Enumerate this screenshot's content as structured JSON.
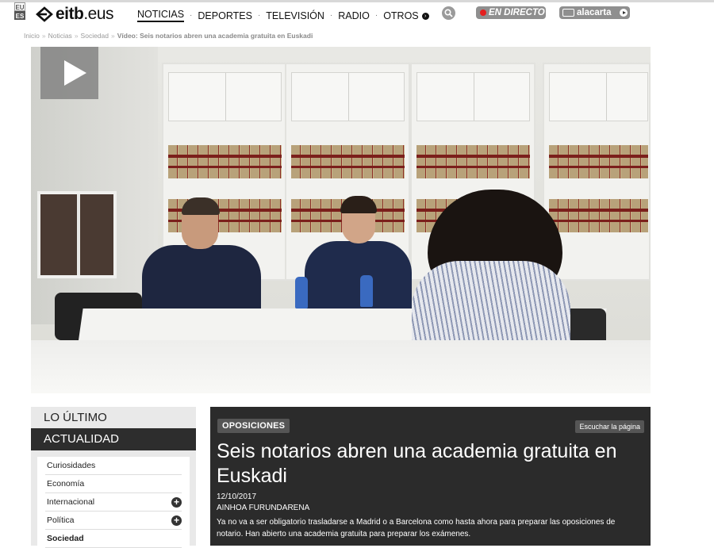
{
  "lang": {
    "eu": "EU",
    "es": "ES"
  },
  "logo": {
    "name": "eitb",
    "suffix": ".eus"
  },
  "nav": {
    "items": [
      "NOTICIAS",
      "DEPORTES",
      "TELEVISIÓN",
      "RADIO",
      "OTROS"
    ],
    "active": "NOTICIAS"
  },
  "header": {
    "live_label": "EN DIRECTO",
    "alacarta_label": "alacarta"
  },
  "breadcrumb": {
    "items": [
      "Inicio",
      "Noticias",
      "Sociedad"
    ],
    "current": "Vídeo: Seis notarios abren una academia gratuita en Euskadi"
  },
  "sidebar": {
    "tab_latest": "LO ÚLTIMO",
    "tab_active": "ACTUALIDAD",
    "items": [
      {
        "label": "Curiosidades",
        "expandable": false
      },
      {
        "label": "Economía",
        "expandable": false
      },
      {
        "label": "Internacional",
        "expandable": true
      },
      {
        "label": "Política",
        "expandable": true
      },
      {
        "label": "Sociedad",
        "expandable": false
      }
    ]
  },
  "article": {
    "category": "OPOSICIONES",
    "listen_label": "Escuchar la página",
    "headline": "Seis notarios abren una academia gratuita en Euskadi",
    "date": "12/10/2017",
    "author": "AINHOA FURUNDARENA",
    "summary": "Ya no va a ser obligatorio trasladarse a Madrid o a Barcelona como hasta ahora para preparar las oposiciones de notario. Han abierto una academia gratuita para preparar los exámenes."
  },
  "colors": {
    "live_dot": "#e41e1e",
    "header_button": "#8f8f8f",
    "article_bg": "#2b2b2b",
    "sidebar_active": "#2d2d2d"
  }
}
